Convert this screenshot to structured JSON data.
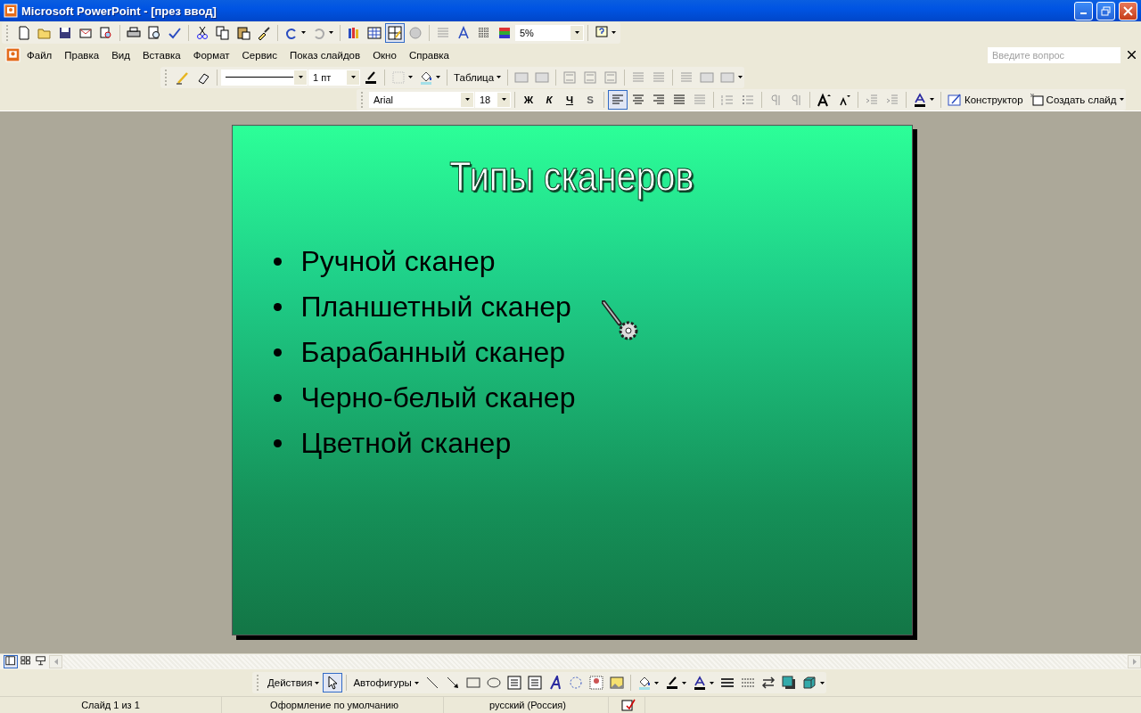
{
  "window": {
    "title": "Microsoft PowerPoint - [през ввод]"
  },
  "standard_toolbar": {
    "zoom": "5%",
    "grid_toggle": {
      "selected": true
    }
  },
  "menu": {
    "items": [
      "Файл",
      "Правка",
      "Вид",
      "Вставка",
      "Формат",
      "Сервис",
      "Показ слайдов",
      "Окно",
      "Справка"
    ]
  },
  "ask_box": {
    "placeholder": "Введите вопрос"
  },
  "tables_toolbar": {
    "line_weight": "1 пт",
    "table_menu": "Таблица"
  },
  "formatting_toolbar": {
    "font": "Arial",
    "size": "18",
    "bold": "Ж",
    "italic": "К",
    "underline": "Ч",
    "shadow": "S",
    "align": [
      {
        "selected": true
      },
      {
        "selected": false
      },
      {
        "selected": false
      }
    ],
    "design": "Конструктор",
    "new_slide": "Создать слайд"
  },
  "slide": {
    "title": "Типы сканеров",
    "bullets": [
      "Ручной сканер",
      "Планшетный сканер",
      "Барабанный сканер",
      "Черно-белый сканер",
      "Цветной сканер"
    ]
  },
  "view_buttons": [
    {
      "selected": true
    },
    {
      "selected": false
    },
    {
      "selected": false
    }
  ],
  "drawing_toolbar": {
    "actions": "Действия",
    "select_tool": {
      "selected": true
    },
    "autoshapes": "Автофигуры"
  },
  "status_bar": {
    "slide": "Слайд 1 из 1",
    "design": "Оформление по умолчанию",
    "language": "русский (Россия)"
  }
}
